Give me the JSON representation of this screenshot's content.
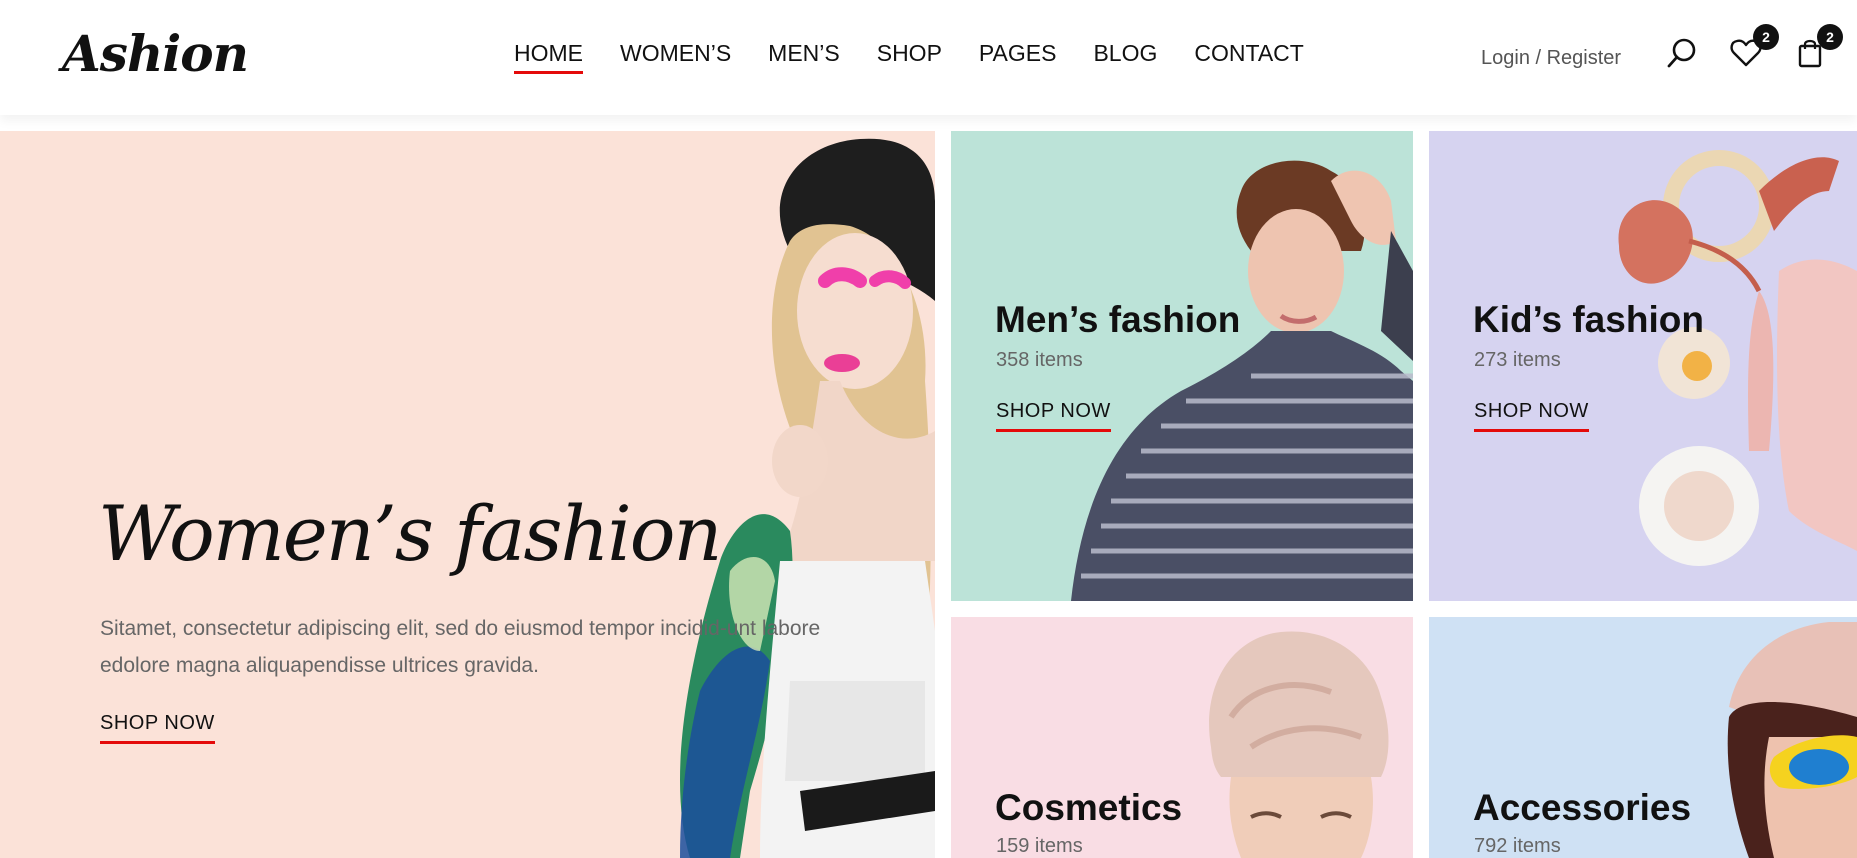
{
  "header": {
    "logo": "Ashion",
    "nav": [
      "HOME",
      "WOMEN’S",
      "MEN’S",
      "SHOP",
      "PAGES",
      "BLOG",
      "CONTACT"
    ],
    "active_nav": "HOME",
    "auth": "Login / Register",
    "icons": {
      "search": "search-icon",
      "wishlist": "heart-icon",
      "cart": "shopping-bag-icon"
    },
    "wishlist_count": "2",
    "cart_count": "2"
  },
  "hero": {
    "title": "Women’s fashion",
    "description": "Sitamet, consectetur adipiscing elit, sed do eiusmod tempor incidid-unt labore edolore magna aliquapendisse ultrices gravida.",
    "cta": "SHOP NOW"
  },
  "categories": [
    {
      "title": "Men’s fashion",
      "count": "358 items",
      "cta": "SHOP NOW"
    },
    {
      "title": "Kid’s fashion",
      "count": "273 items",
      "cta": "SHOP NOW"
    },
    {
      "title": "Cosmetics",
      "count": "159 items"
    },
    {
      "title": "Accessories",
      "count": "792 items"
    }
  ],
  "colors": {
    "accent": "#e40a0a",
    "women_bg": "#fbe2d8",
    "men_bg": "#bce3d8",
    "kids_bg": "#d6d3f0",
    "cosmetics_bg": "#f9dde4",
    "accessories_bg": "#cfe1f4"
  }
}
